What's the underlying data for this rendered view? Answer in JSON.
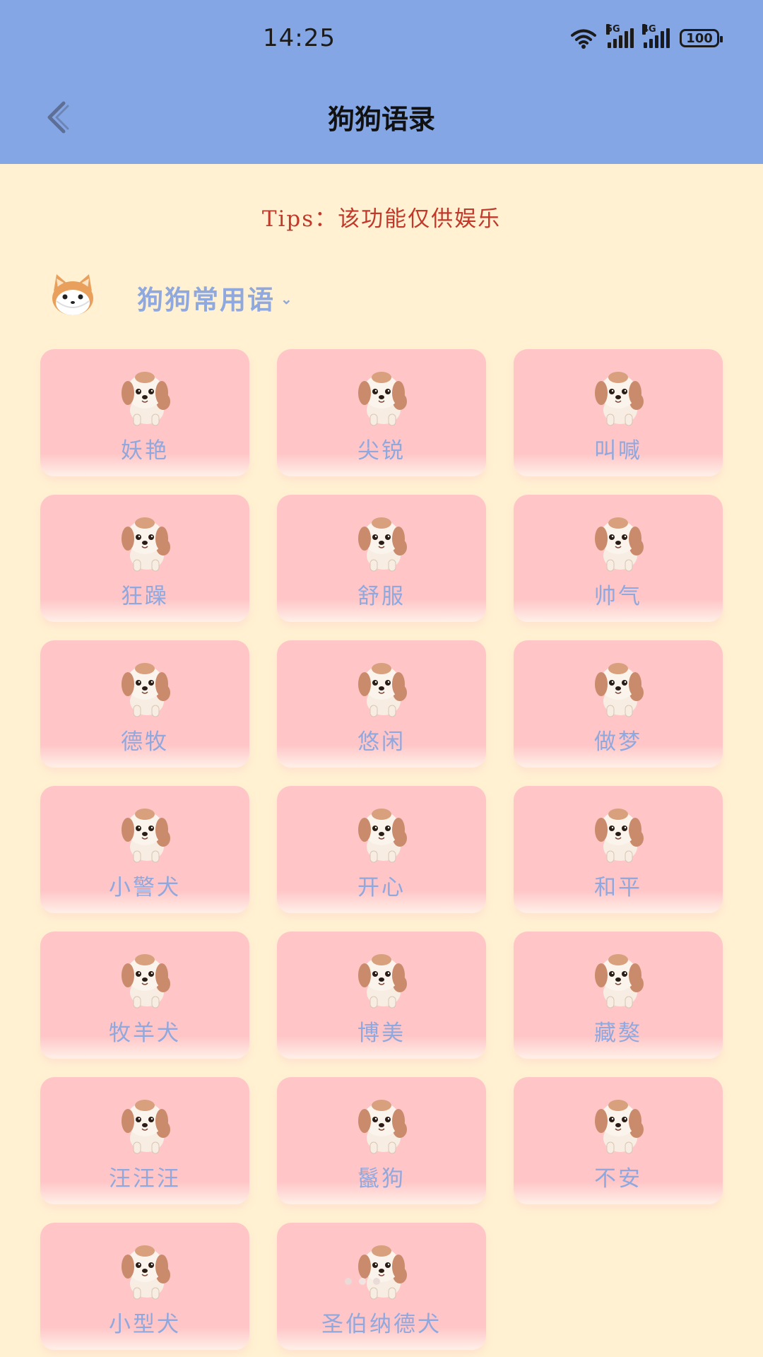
{
  "status_bar": {
    "time": "14:25",
    "battery": "100",
    "network_labels": [
      "5G",
      "4G"
    ],
    "icons": [
      "wifi-icon",
      "signal-5g-icon",
      "signal-4g-icon",
      "battery-icon"
    ]
  },
  "header": {
    "title": "狗狗语录",
    "back_icon": "chevron-left-icon"
  },
  "tips": "Tips：该功能仅供娱乐",
  "category": {
    "label": "狗狗常用语",
    "avatar_icon": "shiba-avatar-icon",
    "chevron_icon": "chevron-down-icon"
  },
  "phrases": [
    "妖艳",
    "尖锐",
    "叫喊",
    "狂躁",
    "舒服",
    "帅气",
    "德牧",
    "悠闲",
    "做梦",
    "小警犬",
    "开心",
    "和平",
    "牧羊犬",
    "博美",
    "藏獒",
    "汪汪汪",
    "鬣狗",
    "不安",
    "小型犬",
    "圣伯纳德犬"
  ],
  "colors": {
    "header_bg": "#85A6E5",
    "page_bg": "#FFF1D2",
    "card_bg": "#FFC5C7",
    "card_text": "#8FA8DE",
    "tips_text": "#C0392B"
  }
}
